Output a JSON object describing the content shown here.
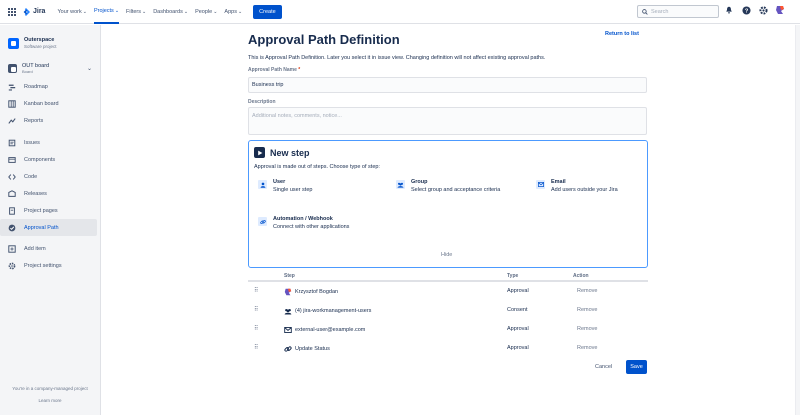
{
  "topnav": {
    "logo": "Jira",
    "items": [
      {
        "label": "Your work",
        "active": false
      },
      {
        "label": "Projects",
        "active": true
      },
      {
        "label": "Filters",
        "active": false
      },
      {
        "label": "Dashboards",
        "active": false
      },
      {
        "label": "People",
        "active": false
      },
      {
        "label": "Apps",
        "active": false
      }
    ],
    "create_label": "Create",
    "search_placeholder": "Search"
  },
  "sidebar": {
    "project_name": "Outerspace",
    "project_type": "Software project",
    "board_title": "OUT board",
    "board_sub": "Board",
    "items": [
      {
        "label": "Roadmap",
        "icon": "roadmap-icon"
      },
      {
        "label": "Kanban board",
        "icon": "board-icon"
      },
      {
        "label": "Reports",
        "icon": "reports-icon"
      },
      {
        "label": "Issues",
        "icon": "issues-icon"
      },
      {
        "label": "Components",
        "icon": "components-icon"
      },
      {
        "label": "Code",
        "icon": "code-icon"
      },
      {
        "label": "Releases",
        "icon": "releases-icon"
      },
      {
        "label": "Project pages",
        "icon": "pages-icon"
      },
      {
        "label": "Approval Path",
        "icon": "approval-icon"
      },
      {
        "label": "Add item",
        "icon": "add-icon"
      },
      {
        "label": "Project settings",
        "icon": "settings-icon"
      }
    ],
    "footer_text": "You're in a company-managed project",
    "footer_link": "Learn more"
  },
  "main": {
    "title": "Approval Path Definition",
    "return_link": "Return to list",
    "intro": "This is Approval Path Definition. Later you select it in issue view. Changing definition will not affect existing approval paths.",
    "name_label": "Approval Path Name",
    "name_required": "*",
    "name_value": "Business trip",
    "description_label": "Description",
    "description_placeholder": "Additional notes, comments, notice..."
  },
  "new_step": {
    "title": "New step",
    "subtitle": "Approval is made out of steps. Choose type of step:",
    "options": [
      {
        "title": "User",
        "desc": "Single user step",
        "icon": "user-icon"
      },
      {
        "title": "Group",
        "desc": "Select group and acceptance criteria",
        "icon": "group-icon"
      },
      {
        "title": "Email",
        "desc": "Add users outside your Jira",
        "icon": "email-icon"
      },
      {
        "title": "Automation / Webhook",
        "desc": "Connect with other applications",
        "icon": "link-icon"
      }
    ],
    "hide_label": "Hide"
  },
  "steps_table": {
    "headers": {
      "step": "Step",
      "type": "Type",
      "action": "Action"
    },
    "rows": [
      {
        "step": "Krzysztof Bogdan",
        "type": "Approval",
        "action": "Remove",
        "icon": "user-avatar-icon"
      },
      {
        "step": "(4) jira-workmanagement-users",
        "type": "Consent",
        "action": "Remove",
        "icon": "group-icon"
      },
      {
        "step": "external-user@example.com",
        "type": "Approval",
        "action": "Remove",
        "icon": "email-icon"
      },
      {
        "step": "Update Status",
        "type": "Approval",
        "action": "Remove",
        "icon": "link-icon"
      }
    ]
  },
  "footer": {
    "cancel_label": "Cancel",
    "save_label": "Save"
  },
  "colors": {
    "brand": "#0052cc",
    "text": "#172b4d",
    "muted": "#6b778c",
    "focus_border": "#4c9aff"
  }
}
